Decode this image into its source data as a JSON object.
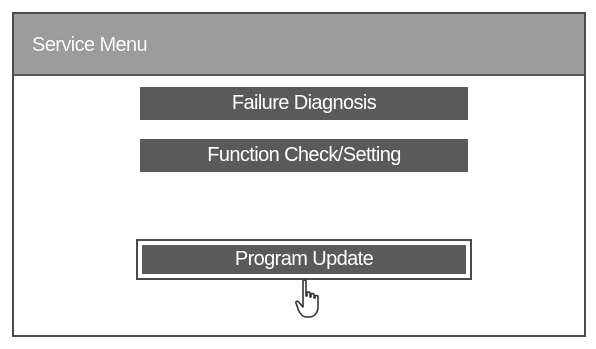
{
  "window": {
    "title": "Service Menu"
  },
  "menu": {
    "items": [
      {
        "label": "Failure Diagnosis",
        "selected": false
      },
      {
        "label": "Function Check/Setting",
        "selected": false
      },
      {
        "label": "Program Update",
        "selected": true
      }
    ]
  },
  "icons": {
    "cursor": "pointing-hand-icon"
  },
  "colors": {
    "title_bar": "#9c9c9c",
    "button": "#5a5a5a",
    "text": "#ffffff"
  }
}
